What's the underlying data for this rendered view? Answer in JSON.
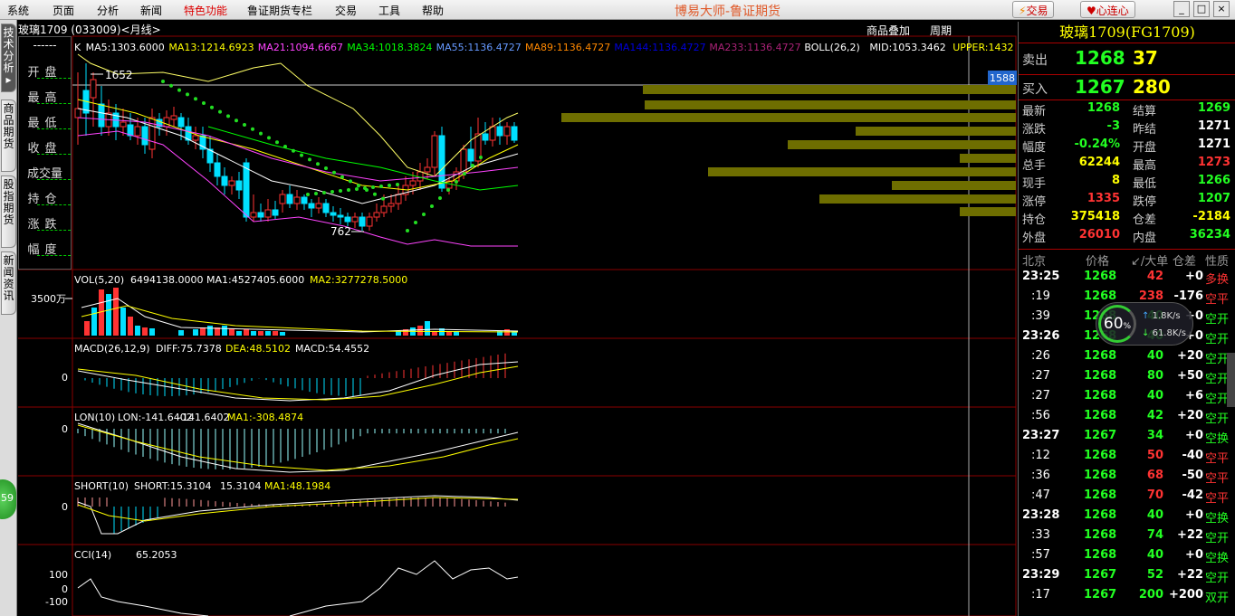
{
  "menu": [
    "系统",
    "页面",
    "分析",
    "新闻",
    "特色功能",
    "鲁证期货专栏",
    "交易",
    "工具",
    "帮助"
  ],
  "app_title": "博易大师-鲁证期货",
  "top_buttons": {
    "trade": "交易",
    "xinlianxin": "心连心"
  },
  "left_tabs": [
    "技术分析",
    "商品期货",
    "股指期货",
    "新闻资讯"
  ],
  "green_badge": "59",
  "ohlc_labels": [
    "开盘",
    "最高",
    "最低",
    "收盘",
    "成交量",
    "持仓",
    "涨跌",
    "幅度"
  ],
  "ohlc_dash": "------",
  "chart_header": {
    "symbol": "玻璃1709 (033009)<月线>",
    "overlay": "商品叠加",
    "period": "周期"
  },
  "ma_line": [
    {
      "text": "K",
      "color": "#ffffff"
    },
    {
      "text": "MA5:1303.6000",
      "color": "#ffffff"
    },
    {
      "text": "MA13:1214.6923",
      "color": "#ffff00"
    },
    {
      "text": "MA21:1094.6667",
      "color": "#ff44ff"
    },
    {
      "text": "MA34:1018.3824",
      "color": "#00ff00"
    },
    {
      "text": "MA55:1136.4727",
      "color": "#6699ff"
    },
    {
      "text": "MA89:1136.4727",
      "color": "#ff8800"
    },
    {
      "text": "MA144:1136.4727",
      "color": "#0000dd"
    },
    {
      "text": "MA233:1136.4727",
      "color": "#aa2277"
    },
    {
      "text": "BOLL(26,2)",
      "color": "#ffffff"
    },
    {
      "text": "MID:1053.3462",
      "color": "#ffffff"
    },
    {
      "text": "UPPER:1432",
      "color": "#ffff00"
    }
  ],
  "price_marks": {
    "high": "1652",
    "low": "762",
    "right_price": "1588"
  },
  "vol": {
    "header": "VOL(5,20)",
    "v": "6494138.0000",
    "ma1": "MA1:4527405.6000",
    "ma2": "MA2:3277278.5000",
    "axis": "3500万"
  },
  "macd": {
    "header": "MACD(26,12,9)",
    "diff": "DIFF:75.7378",
    "dea": "DEA:48.5102",
    "macd": "MACD:54.4552",
    "axis": "0"
  },
  "lon": {
    "header": "LON(10)",
    "lon": "LON:-141.6402",
    "val": "-141.6402",
    "ma1": "MA1:-308.4874",
    "axis": "0"
  },
  "short": {
    "header": "SHORT(10)",
    "short": "SHORT:15.3104",
    "val": "15.3104",
    "ma1": "MA1:48.1984",
    "axis": "0"
  },
  "cci": {
    "header": "CCI(14)",
    "val": "65.2053",
    "axis": [
      "100",
      "0",
      "-100"
    ]
  },
  "quote": {
    "title": "玻璃1709(FG1709)",
    "sell_label": "卖出",
    "sell_price": "1268",
    "sell_vol": "37",
    "buy_label": "买入",
    "buy_price": "1267",
    "buy_vol": "280",
    "rows": [
      {
        "l1": "最新",
        "v1": "1268",
        "c1": "g",
        "l2": "结算",
        "v2": "1269",
        "c2": "g"
      },
      {
        "l1": "涨跌",
        "v1": "-3",
        "c1": "g",
        "l2": "昨结",
        "v2": "1271",
        "c2": "w"
      },
      {
        "l1": "幅度",
        "v1": "-0.24%",
        "c1": "g",
        "l2": "开盘",
        "v2": "1271",
        "c2": "w"
      },
      {
        "l1": "总手",
        "v1": "62244",
        "c1": "y",
        "l2": "最高",
        "v2": "1273",
        "c2": "r"
      },
      {
        "l1": "现手",
        "v1": "8",
        "c1": "y",
        "l2": "最低",
        "v2": "1266",
        "c2": "g"
      },
      {
        "l1": "涨停",
        "v1": "1335",
        "c1": "r",
        "l2": "跌停",
        "v2": "1207",
        "c2": "g"
      },
      {
        "l1": "持仓",
        "v1": "375418",
        "c1": "y",
        "l2": "仓差",
        "v2": "-2184",
        "c2": "y"
      },
      {
        "l1": "外盘",
        "v1": "26010",
        "c1": "r",
        "l2": "内盘",
        "v2": "36234",
        "c2": "g"
      }
    ],
    "tick_header": {
      "c0": "北京",
      "c1": "价格",
      "c2": "↙/大单",
      "c3": "仓差",
      "c4": "性质"
    },
    "ticks": [
      {
        "t": "23:25",
        "p": "1268",
        "v": "42",
        "vc": "r",
        "d": "+0",
        "n": "多换",
        "nc": "r",
        "big": true
      },
      {
        "t": ":19",
        "p": "1268",
        "v": "238",
        "vc": "r",
        "d": "-176",
        "n": "空平",
        "nc": "r",
        "big": false
      },
      {
        "t": ":39",
        "p": "1268",
        "v": "40",
        "vc": "g",
        "d": "+0",
        "n": "空开",
        "nc": "g",
        "big": false
      },
      {
        "t": "23:26",
        "p": "1268",
        "v": "40",
        "vc": "g",
        "d": "+0",
        "n": "空开",
        "nc": "g",
        "big": true
      },
      {
        "t": ":26",
        "p": "1268",
        "v": "40",
        "vc": "g",
        "d": "+20",
        "n": "空开",
        "nc": "g",
        "big": false
      },
      {
        "t": ":27",
        "p": "1268",
        "v": "80",
        "vc": "g",
        "d": "+50",
        "n": "空开",
        "nc": "g",
        "big": false
      },
      {
        "t": ":27",
        "p": "1268",
        "v": "40",
        "vc": "g",
        "d": "+6",
        "n": "空开",
        "nc": "g",
        "big": false
      },
      {
        "t": ":56",
        "p": "1268",
        "v": "42",
        "vc": "g",
        "d": "+20",
        "n": "空开",
        "nc": "g",
        "big": false
      },
      {
        "t": "23:27",
        "p": "1267",
        "v": "34",
        "vc": "g",
        "d": "+0",
        "n": "空换",
        "nc": "g",
        "big": true
      },
      {
        "t": ":12",
        "p": "1268",
        "v": "50",
        "vc": "r",
        "d": "-40",
        "n": "空平",
        "nc": "r",
        "big": false
      },
      {
        "t": ":36",
        "p": "1268",
        "v": "68",
        "vc": "r",
        "d": "-50",
        "n": "空平",
        "nc": "r",
        "big": false
      },
      {
        "t": ":47",
        "p": "1268",
        "v": "70",
        "vc": "r",
        "d": "-42",
        "n": "空平",
        "nc": "r",
        "big": false
      },
      {
        "t": "23:28",
        "p": "1268",
        "v": "40",
        "vc": "g",
        "d": "+0",
        "n": "空换",
        "nc": "g",
        "big": true
      },
      {
        "t": ":33",
        "p": "1268",
        "v": "74",
        "vc": "g",
        "d": "+22",
        "n": "空开",
        "nc": "g",
        "big": false
      },
      {
        "t": ":57",
        "p": "1268",
        "v": "40",
        "vc": "g",
        "d": "+0",
        "n": "空换",
        "nc": "g",
        "big": false
      },
      {
        "t": "23:29",
        "p": "1267",
        "v": "52",
        "vc": "g",
        "d": "+22",
        "n": "空开",
        "nc": "g",
        "big": true
      },
      {
        "t": ":17",
        "p": "1267",
        "v": "200",
        "vc": "g",
        "d": "+200",
        "n": "双开",
        "nc": "g",
        "big": false
      }
    ]
  },
  "speed": {
    "pct": "60",
    "unit": "%",
    "up": "1.8K/s",
    "down": "61.8K/s"
  },
  "colors": {
    "up": "#ff3333",
    "down": "#00e0ff",
    "grid": "#8a0000",
    "volprofile": "#6e6e00"
  }
}
